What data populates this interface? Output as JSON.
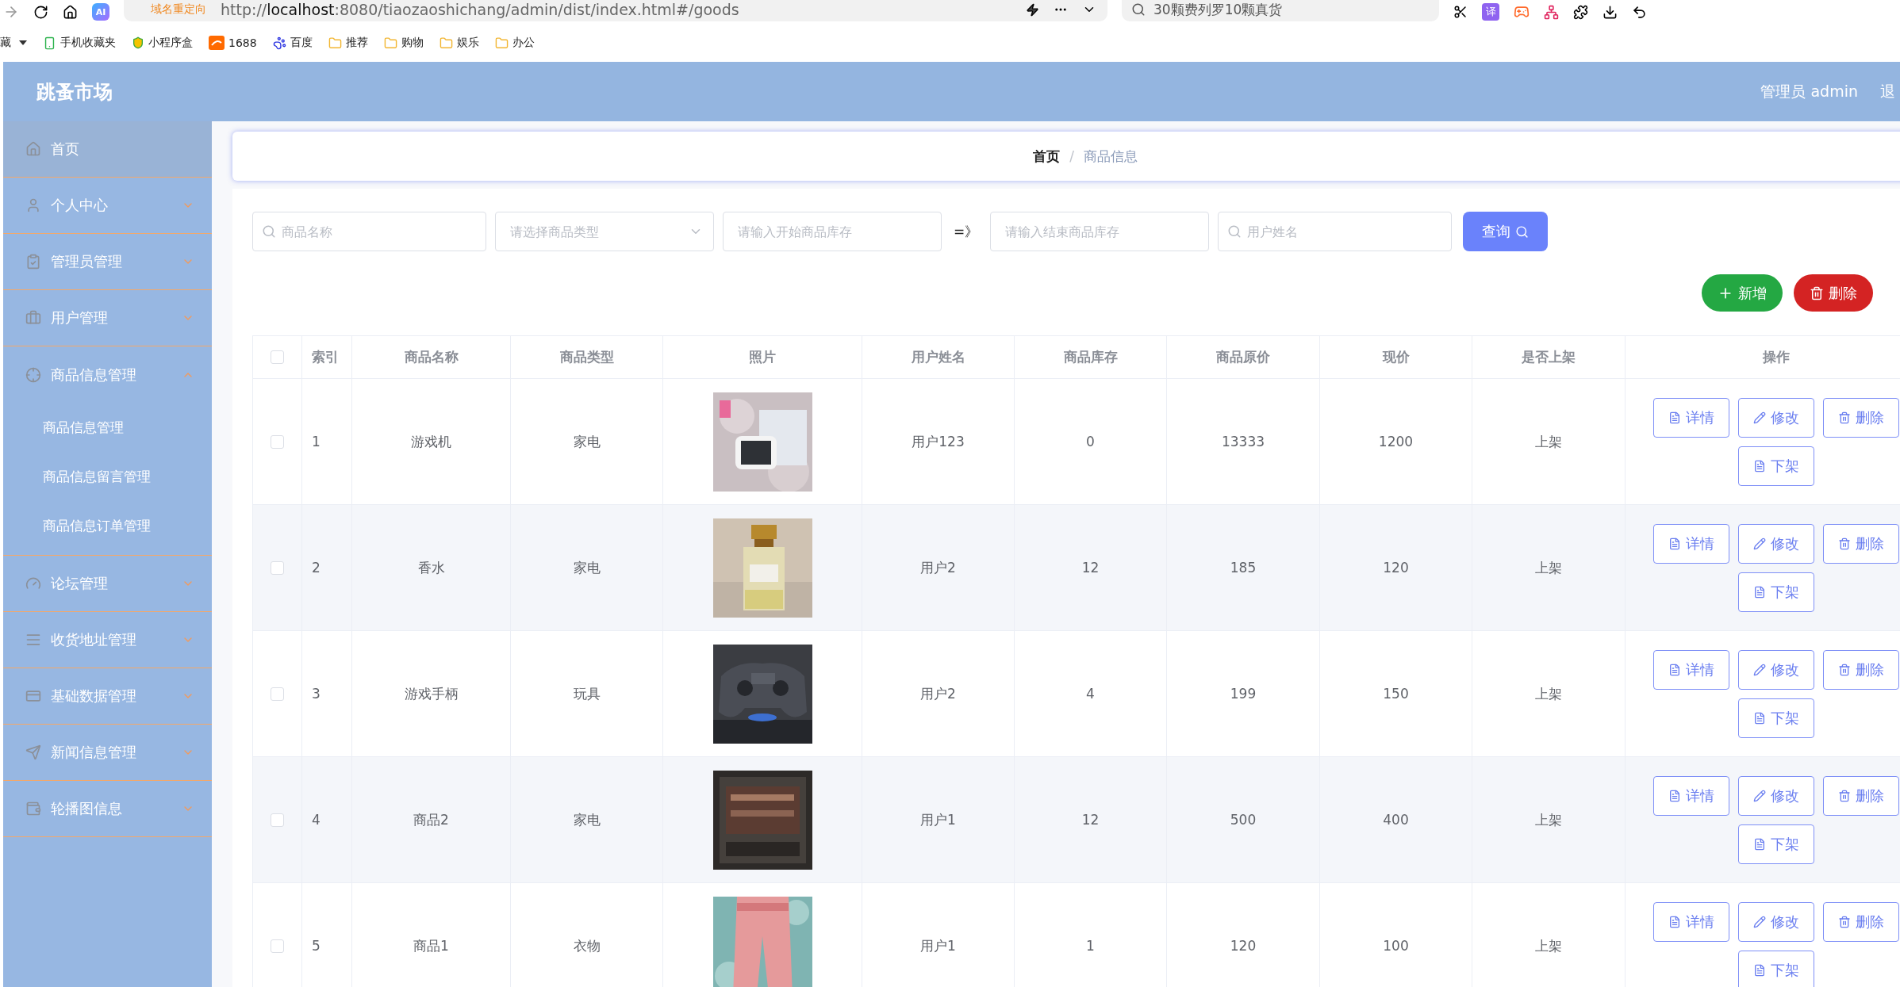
{
  "browser": {
    "logo_text": "AI",
    "redirect_label": "域名重定向",
    "url": "http://**localhost**:8080/tiaozaoshichang/admin/dist/index.html#/goods",
    "search_text": "30颗费列罗10颗真货",
    "translate_label": "译",
    "bookmarks_cut": "藏",
    "bookmarks": [
      "手机收藏夹",
      "小程序盒",
      "1688",
      "百度",
      "推荐",
      "购物",
      "娱乐",
      "办公"
    ]
  },
  "header": {
    "title": "跳蚤市场",
    "user": "管理员 admin",
    "logout": "退"
  },
  "sidebar": {
    "items": [
      {
        "kind": "link",
        "label": "首页",
        "selected": true
      },
      {
        "kind": "submenu",
        "label": "个人中心",
        "selected": false,
        "expanded": false
      },
      {
        "kind": "submenu",
        "label": "管理员管理",
        "selected": false,
        "expanded": false
      },
      {
        "kind": "submenu",
        "label": "用户管理",
        "selected": false,
        "expanded": false
      },
      {
        "kind": "submenu",
        "label": "商品信息管理",
        "selected": false,
        "expanded": true,
        "children": [
          {
            "label": "商品信息管理",
            "selected": false
          },
          {
            "label": "商品信息留言管理",
            "selected": false
          },
          {
            "label": "商品信息订单管理",
            "selected": false
          }
        ]
      },
      {
        "kind": "submenu",
        "label": "论坛管理",
        "selected": false,
        "expanded": false
      },
      {
        "kind": "submenu",
        "label": "收货地址管理",
        "selected": false,
        "expanded": false
      },
      {
        "kind": "submenu",
        "label": "基础数据管理",
        "selected": false,
        "expanded": false
      },
      {
        "kind": "submenu",
        "label": "新闻信息管理",
        "selected": false,
        "expanded": false
      },
      {
        "kind": "submenu",
        "label": "轮播图信息",
        "selected": false,
        "expanded": false
      }
    ]
  },
  "breadcrumb": [
    "首页",
    "商品信息"
  ],
  "breadcrumb_separator": "/",
  "filters": [
    {
      "kind": "search",
      "placeholder": "商品名称"
    },
    {
      "kind": "select",
      "placeholder": "请选择商品类型"
    },
    {
      "kind": "text",
      "placeholder": "请输入开始商品库存"
    },
    {
      "kind": "separator",
      "text": "=》"
    },
    {
      "kind": "text",
      "placeholder": "请输入结束商品库存"
    },
    {
      "kind": "search",
      "placeholder": "用户姓名"
    }
  ],
  "query_button": "查询",
  "actions": [
    {
      "kind": "add",
      "label": "新增"
    },
    {
      "kind": "delete",
      "label": "删除"
    }
  ],
  "table": {
    "select_all_checked": false,
    "columns": [
      "索引",
      "商品名称",
      "商品类型",
      "照片",
      "用户姓名",
      "商品库存",
      "商品原价",
      "现价",
      "是否上架",
      "操作"
    ],
    "rows": [
      {
        "checked": false,
        "index": "1",
        "name": "游戏机",
        "type": "家电",
        "photo": {
          "kind": "picture"
        },
        "user": "用户123",
        "stock": "0",
        "price": "13333",
        "current": "1200",
        "status": "上架",
        "actions": [
          "详情",
          "修改",
          "删除",
          "下架"
        ]
      },
      {
        "checked": false,
        "index": "2",
        "name": "香水",
        "type": "家电",
        "photo": {
          "kind": "picture"
        },
        "user": "用户2",
        "stock": "12",
        "price": "185",
        "current": "120",
        "status": "上架",
        "actions": [
          "详情",
          "修改",
          "删除",
          "下架"
        ]
      },
      {
        "checked": false,
        "index": "3",
        "name": "游戏手柄",
        "type": "玩具",
        "photo": {
          "kind": "picture"
        },
        "user": "用户2",
        "stock": "4",
        "price": "199",
        "current": "150",
        "status": "上架",
        "actions": [
          "详情",
          "修改",
          "删除",
          "下架"
        ]
      },
      {
        "checked": false,
        "index": "4",
        "name": "商品2",
        "type": "家电",
        "photo": {
          "kind": "picture"
        },
        "user": "用户1",
        "stock": "12",
        "price": "500",
        "current": "400",
        "status": "上架",
        "actions": [
          "详情",
          "修改",
          "删除",
          "下架"
        ]
      },
      {
        "checked": false,
        "index": "5",
        "name": "商品1",
        "type": "衣物",
        "photo": {
          "kind": "picture"
        },
        "user": "用户1",
        "stock": "1",
        "price": "120",
        "current": "100",
        "status": "上架",
        "actions": [
          "详情",
          "修改",
          "删除",
          "下架"
        ]
      }
    ]
  }
}
